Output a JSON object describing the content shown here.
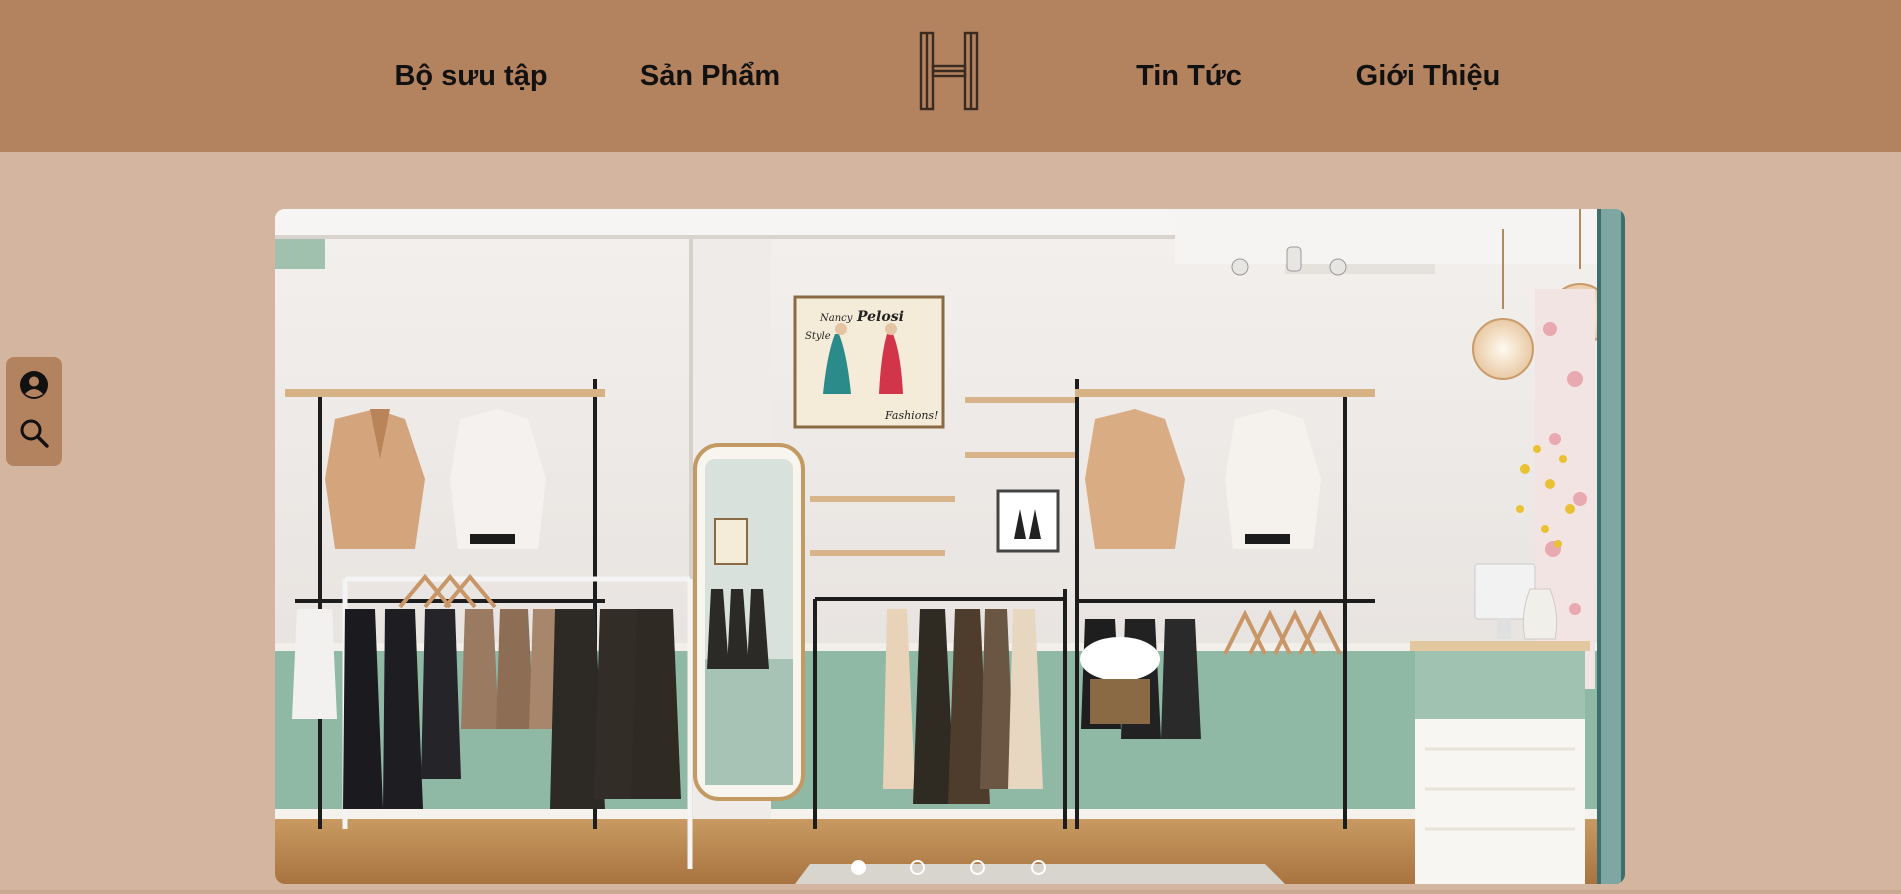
{
  "header": {
    "nav": [
      {
        "label": "Bộ sưu tập"
      },
      {
        "label": "Sản Phẩm"
      },
      {
        "label": "Tin Tức"
      },
      {
        "label": "Giới Thiệu"
      }
    ],
    "logo_letter": "H"
  },
  "side_panel": {
    "icons": [
      "user-circle-icon",
      "search-icon"
    ]
  },
  "hero": {
    "image_description_alt": "Boutique interior",
    "poster": {
      "line1": "Nancy",
      "line2": "Pelosi",
      "line3": "Style",
      "line4": "Fashions!"
    },
    "slides_total": 4,
    "active_slide": 1
  },
  "colors": {
    "header_bg": "#b3825f",
    "page_bg": "#d4b5a0",
    "nav_text": "#111111"
  }
}
